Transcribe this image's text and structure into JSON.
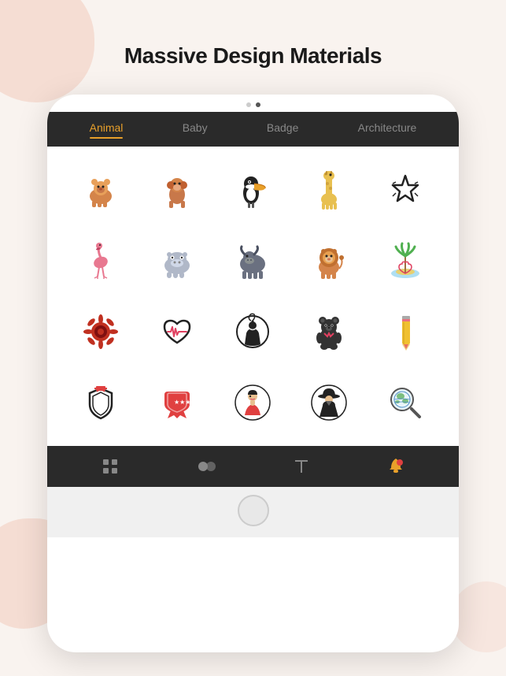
{
  "page": {
    "title": "Massive Design Materials",
    "background_color": "#f9f3ef"
  },
  "device": {
    "dots": [
      {
        "active": false
      },
      {
        "active": true
      }
    ]
  },
  "categories": [
    {
      "label": "Animal",
      "active": true
    },
    {
      "label": "Baby",
      "active": false
    },
    {
      "label": "Badge",
      "active": false
    },
    {
      "label": "Architecture",
      "active": false
    }
  ],
  "icon_rows": [
    [
      {
        "name": "lion-cub",
        "emoji": "🦁"
      },
      {
        "name": "monkey",
        "emoji": "🐒"
      },
      {
        "name": "toucan",
        "emoji": "🦜"
      },
      {
        "name": "giraffe",
        "emoji": "🦒"
      },
      {
        "name": "star-sketch",
        "emoji": "⭐"
      }
    ],
    [
      {
        "name": "flamingo",
        "emoji": "🦩"
      },
      {
        "name": "hippo",
        "emoji": "🦛"
      },
      {
        "name": "bull",
        "emoji": "🐃"
      },
      {
        "name": "lion",
        "emoji": "🦁"
      },
      {
        "name": "tropical-scene",
        "emoji": "🌴"
      }
    ],
    [
      {
        "name": "sunflower-badge",
        "emoji": "🌻"
      },
      {
        "name": "heart-monitor",
        "emoji": "💗"
      },
      {
        "name": "woman-figure",
        "emoji": "👤"
      },
      {
        "name": "bear",
        "emoji": "🧸"
      },
      {
        "name": "pencil",
        "emoji": "✏️"
      }
    ],
    [
      {
        "name": "shield-badge",
        "emoji": "🛡️"
      },
      {
        "name": "ribbon-badge",
        "emoji": "🎖️"
      },
      {
        "name": "lady-hat",
        "emoji": "👒"
      },
      {
        "name": "hat-figure",
        "emoji": "🎩"
      },
      {
        "name": "magnifier-globe",
        "emoji": "🔍"
      }
    ]
  ],
  "toolbar": {
    "items": [
      {
        "name": "grid-tool",
        "symbol": "▦",
        "active": false
      },
      {
        "name": "layers-tool",
        "symbol": "⬤⬤",
        "active": false
      },
      {
        "name": "text-tool",
        "symbol": "T",
        "active": false
      },
      {
        "name": "notification-tool",
        "symbol": "🔔",
        "active": true
      }
    ]
  }
}
